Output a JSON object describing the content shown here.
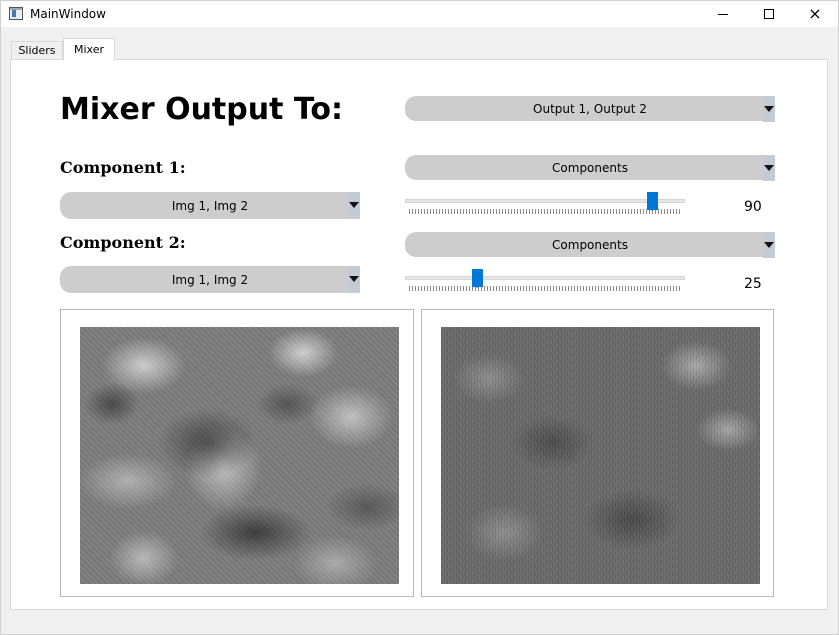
{
  "window": {
    "title": "MainWindow",
    "icon": "app-window-icon",
    "controls": {
      "minimize": "minimize-icon",
      "maximize": "maximize-icon",
      "close": "×"
    }
  },
  "tabs": [
    {
      "label": "Sliders",
      "active": false
    },
    {
      "label": "Mixer",
      "active": true
    }
  ],
  "mixer": {
    "title": "Mixer Output To:",
    "output_select": {
      "value": "Output 1, Output 2"
    },
    "component1": {
      "label": "Component 1:",
      "type_select": {
        "value": "Components"
      },
      "image_select": {
        "value": "Img 1, Img 2"
      },
      "slider_value": 90,
      "slider_value_text": "90"
    },
    "component2": {
      "label": "Component 2:",
      "type_select": {
        "value": "Components"
      },
      "image_select": {
        "value": "Img 1, Img 2"
      },
      "slider_value": 25,
      "slider_value_text": "25"
    },
    "outputs": [
      {
        "name": "output-1-view",
        "content": "grayscale noise image"
      },
      {
        "name": "output-2-view",
        "content": "grayscale noise image"
      }
    ]
  },
  "colors": {
    "accent": "#0078d7",
    "combo_bg": "#cdcdcd",
    "panel_bg": "#ffffff",
    "window_bg": "#f0f0f0"
  }
}
